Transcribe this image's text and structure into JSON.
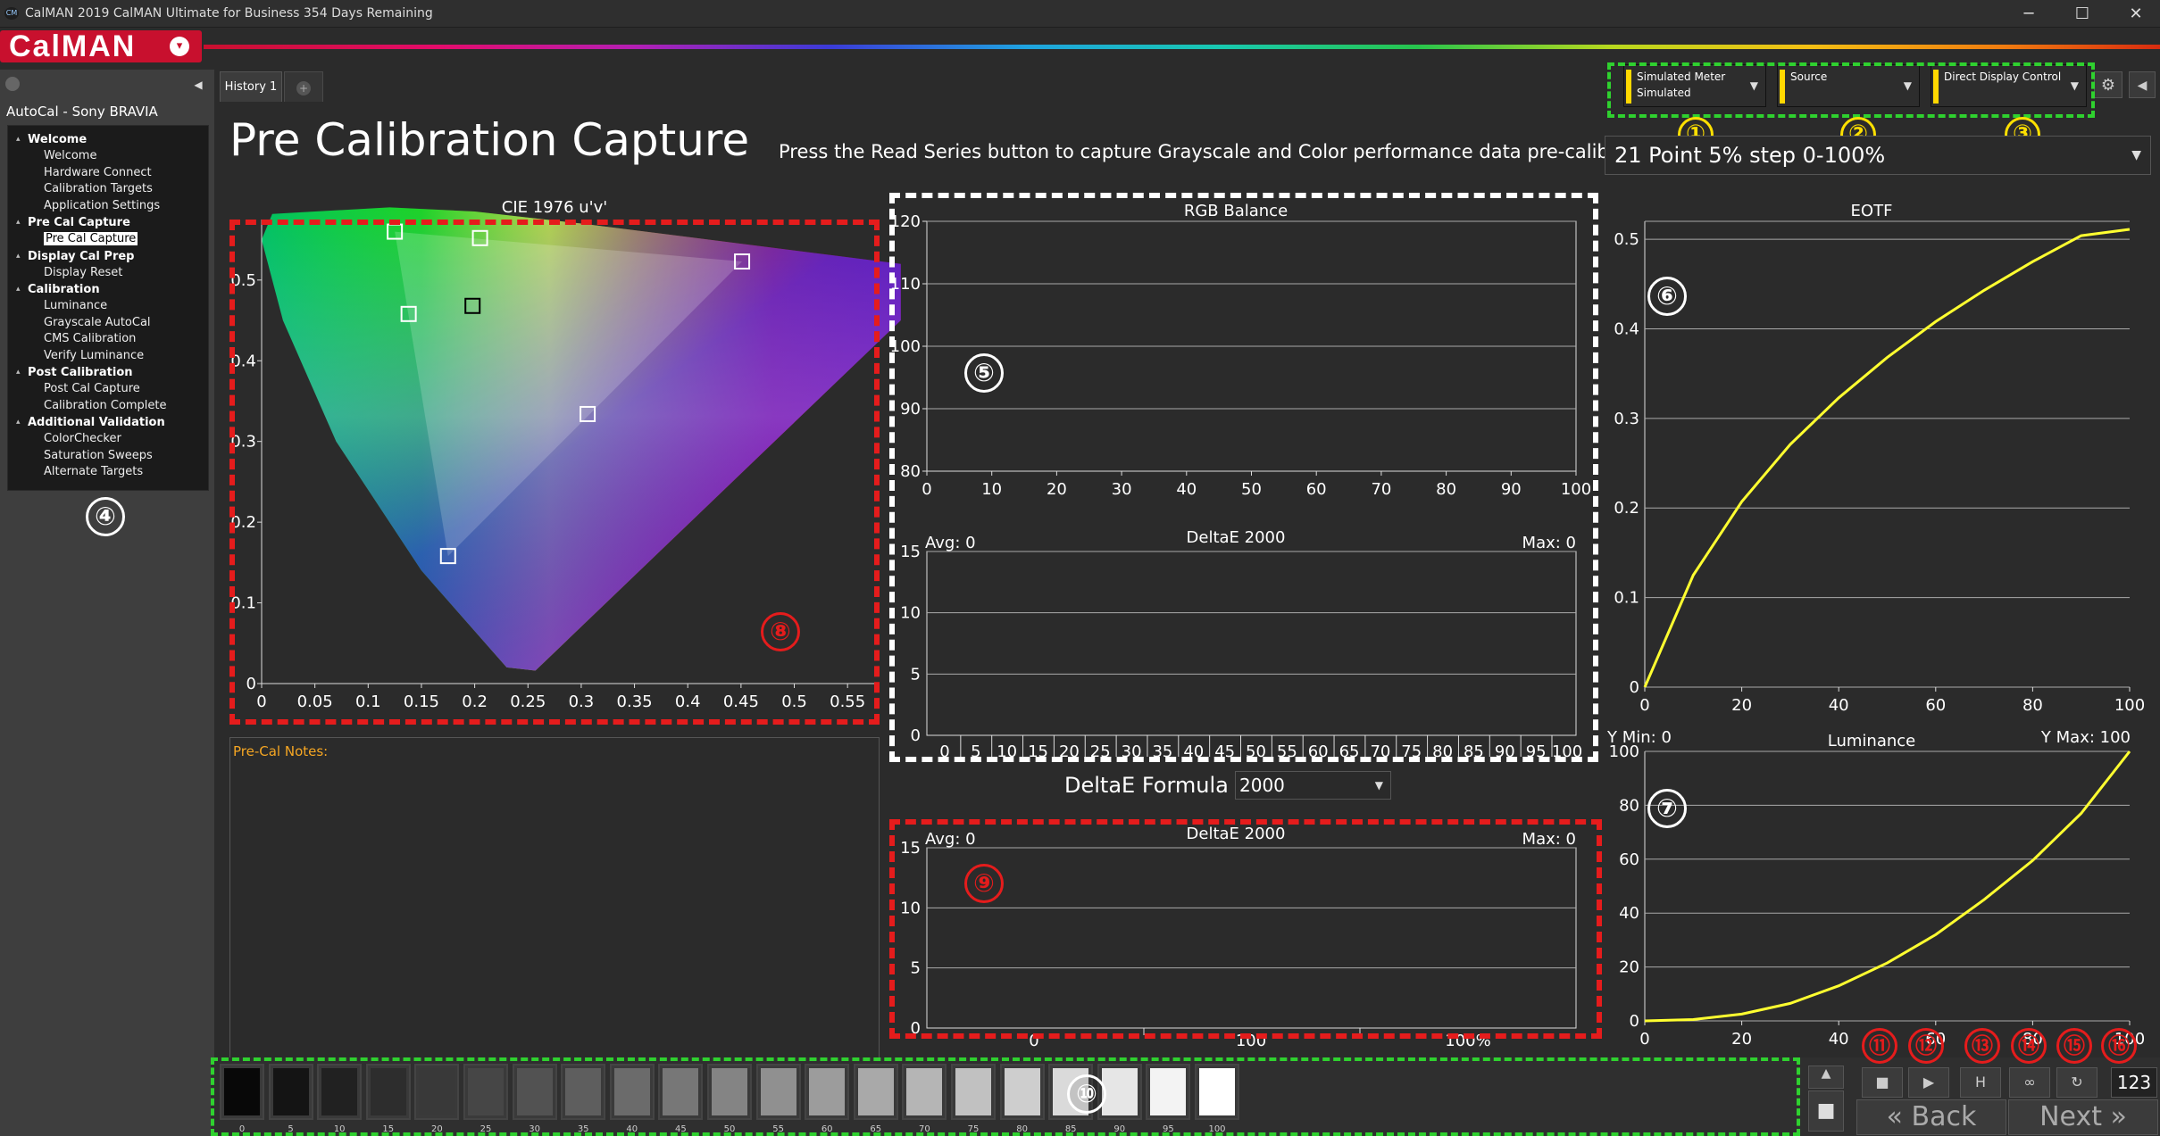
{
  "window": {
    "title": "CalMAN 2019 CalMAN Ultimate for Business 354 Days Remaining",
    "app_icon": "CM"
  },
  "logo": {
    "text": "CalMAN"
  },
  "workflow": {
    "title": "AutoCal - Sony BRAVIA",
    "sections": [
      {
        "label": "Welcome",
        "items": [
          "Welcome",
          "Hardware Connect",
          "Calibration Targets",
          "Application Settings"
        ]
      },
      {
        "label": "Pre Cal Capture",
        "items": [
          "Pre Cal Capture"
        ]
      },
      {
        "label": "Display Cal Prep",
        "items": [
          "Display Reset"
        ]
      },
      {
        "label": "Calibration",
        "items": [
          "Luminance",
          "Grayscale AutoCal",
          "CMS Calibration",
          "Verify Luminance"
        ]
      },
      {
        "label": "Post Calibration",
        "items": [
          "Post Cal Capture",
          "Calibration Complete"
        ]
      },
      {
        "label": "Additional Validation",
        "items": [
          "ColorChecker",
          "Saturation Sweeps",
          "Alternate Targets"
        ]
      }
    ],
    "selected": "Pre Cal Capture"
  },
  "tabs": {
    "history": "History 1",
    "add": "+"
  },
  "page": {
    "title": "Pre Calibration Capture",
    "instructions": "Press the Read Series button to capture Grayscale and Color performance data pre-calibration."
  },
  "devices": {
    "meter": {
      "line1": "Simulated Meter",
      "line2": "Simulated"
    },
    "source": {
      "line1": "Source"
    },
    "display": {
      "line1": "Direct Display Control"
    }
  },
  "series_select": "21 Point 5% step 0-100%",
  "deltae_formula": {
    "label": "DeltaE Formula",
    "value": "2000"
  },
  "notes": {
    "label": "Pre-Cal Notes:"
  },
  "markers": [
    "①",
    "②",
    "③",
    "④",
    "⑤",
    "⑥",
    "⑦",
    "⑧",
    "⑨",
    "⑩",
    "⑪",
    "⑫",
    "⑬",
    "⑭",
    "⑮",
    "⑯"
  ],
  "controls": {
    "back": "Back",
    "next": "Next",
    "count": "123"
  },
  "colors": {
    "accent_red": "#c8102e",
    "curve_yellow": "#ffff30",
    "annot_green": "#2fd12f"
  },
  "swatches": {
    "labels": [
      "0",
      "5",
      "10",
      "15",
      "20",
      "25",
      "30",
      "35",
      "40",
      "45",
      "50",
      "55",
      "60",
      "65",
      "70",
      "75",
      "80",
      "85",
      "90",
      "95",
      "100"
    ],
    "levels": [
      0,
      5,
      10,
      15,
      20,
      25,
      30,
      35,
      40,
      45,
      50,
      55,
      60,
      65,
      70,
      75,
      80,
      85,
      90,
      95,
      100
    ]
  },
  "chart_data": [
    {
      "type": "scatter",
      "title": "CIE 1976 u'v'",
      "xlim": [
        0,
        0.6
      ],
      "ylim": [
        0,
        0.6
      ],
      "xticks": [
        "0",
        "0.05",
        "0.1",
        "0.15",
        "0.2",
        "0.25",
        "0.3",
        "0.35",
        "0.4",
        "0.45",
        "0.5",
        "0.55"
      ],
      "yticks": [
        "0",
        "0.1",
        "0.2",
        "0.3",
        "0.4",
        "0.5"
      ],
      "series": [
        {
          "points": [
            [
              0.125,
              0.56
            ],
            [
              0.205,
              0.552
            ],
            [
              0.451,
              0.523
            ],
            [
              0.138,
              0.458
            ],
            [
              0.198,
              0.468
            ],
            [
              0.306,
              0.334
            ],
            [
              0.175,
              0.158
            ]
          ]
        }
      ]
    },
    {
      "type": "line",
      "title": "RGB Balance",
      "xlim": [
        0,
        100
      ],
      "ylim": [
        80,
        120
      ],
      "xticks": [
        "0",
        "10",
        "20",
        "30",
        "40",
        "50",
        "60",
        "70",
        "80",
        "90",
        "100"
      ],
      "yticks": [
        "80",
        "90",
        "100",
        "110",
        "120"
      ],
      "series": []
    },
    {
      "type": "bar",
      "title": "DeltaE 2000",
      "avg_label": "Avg: 0",
      "max_label": "Max: 0",
      "ylim": [
        0,
        15
      ],
      "categories": [
        "0",
        "5",
        "10",
        "15",
        "20",
        "25",
        "30",
        "35",
        "40",
        "45",
        "50",
        "55",
        "60",
        "65",
        "70",
        "75",
        "80",
        "85",
        "90",
        "95",
        "100"
      ],
      "yticks": [
        "0",
        "5",
        "10",
        "15"
      ],
      "values": []
    },
    {
      "type": "bar",
      "title": "DeltaE 2000",
      "avg_label": "Avg: 0",
      "max_label": "Max: 0",
      "ylim": [
        0,
        15
      ],
      "categories": [
        "0",
        "100",
        "100%"
      ],
      "yticks": [
        "0",
        "5",
        "10",
        "15"
      ],
      "values": []
    },
    {
      "type": "line",
      "title": "EOTF",
      "xlim": [
        0,
        100
      ],
      "ylim": [
        0,
        0.52
      ],
      "xticks": [
        "0",
        "20",
        "40",
        "60",
        "80",
        "100"
      ],
      "yticks": [
        "0",
        "0.1",
        "0.2",
        "0.3",
        "0.4",
        "0.5"
      ],
      "series": [
        {
          "x": [
            0,
            10,
            20,
            30,
            40,
            50,
            60,
            70,
            80,
            90,
            100
          ],
          "values": [
            0,
            0.125,
            0.207,
            0.271,
            0.323,
            0.368,
            0.408,
            0.443,
            0.475,
            0.504,
            0.511
          ]
        }
      ]
    },
    {
      "type": "line",
      "title": "Luminance",
      "ymin_label": "Y Min: 0",
      "ymax_label": "Y Max: 100",
      "xlim": [
        0,
        100
      ],
      "ylim": [
        0,
        100
      ],
      "xticks": [
        "0",
        "20",
        "40",
        "60",
        "80",
        "100"
      ],
      "yticks": [
        "0",
        "20",
        "40",
        "60",
        "80",
        "100"
      ],
      "series": [
        {
          "x": [
            0,
            10,
            20,
            30,
            40,
            50,
            60,
            70,
            80,
            90,
            100
          ],
          "values": [
            0,
            0.5,
            2.5,
            6.5,
            13,
            21.5,
            32,
            45,
            59.5,
            77,
            100
          ]
        }
      ]
    }
  ]
}
